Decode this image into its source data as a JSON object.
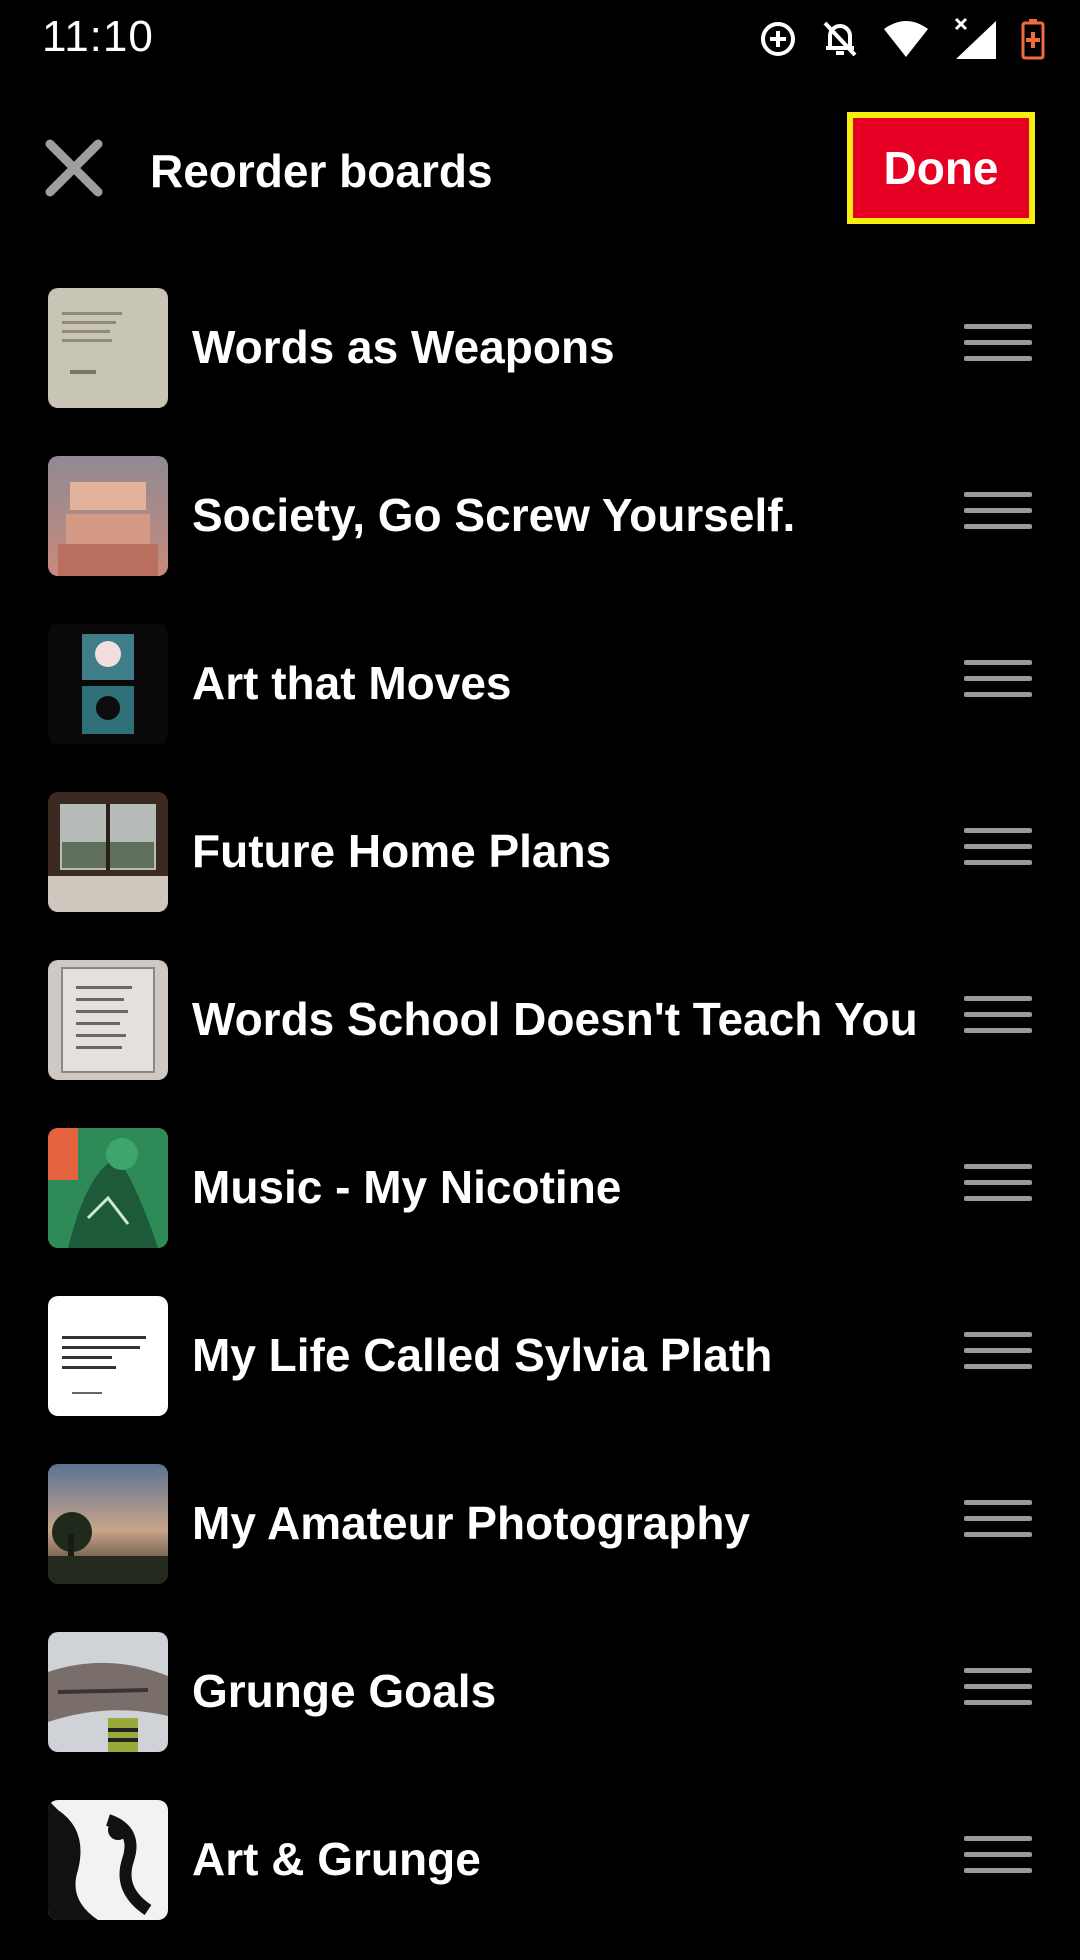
{
  "status_bar": {
    "time": "11:10",
    "icons": [
      "data-saver-icon",
      "notifications-off-icon",
      "wifi-icon",
      "cell-signal-icon",
      "battery-charging-icon"
    ]
  },
  "header": {
    "title": "Reorder boards",
    "close_icon": "close-icon",
    "done_label": "Done"
  },
  "colors": {
    "background": "#000000",
    "accent": "#e60023",
    "highlight_border": "#f6ee0e",
    "handle": "#9a9a9a"
  },
  "boards": [
    {
      "name": "Words as Weapons",
      "thumb": "quote-paper"
    },
    {
      "name": "Society, Go Screw Yourself.",
      "thumb": "21st-century-sucks"
    },
    {
      "name": "Art that Moves",
      "thumb": "illustration-dark"
    },
    {
      "name": "Future Home Plans",
      "thumb": "window-view"
    },
    {
      "name": "Words School Doesn't Teach You",
      "thumb": "poem-page"
    },
    {
      "name": "Music - My Nicotine",
      "thumb": "green-illustration"
    },
    {
      "name": "My Life Called Sylvia Plath",
      "thumb": "quote-white"
    },
    {
      "name": "My Amateur Photography",
      "thumb": "sunset-sky"
    },
    {
      "name": "Grunge Goals",
      "thumb": "grunge-photo"
    },
    {
      "name": "Art & Grunge",
      "thumb": "bw-art"
    }
  ]
}
